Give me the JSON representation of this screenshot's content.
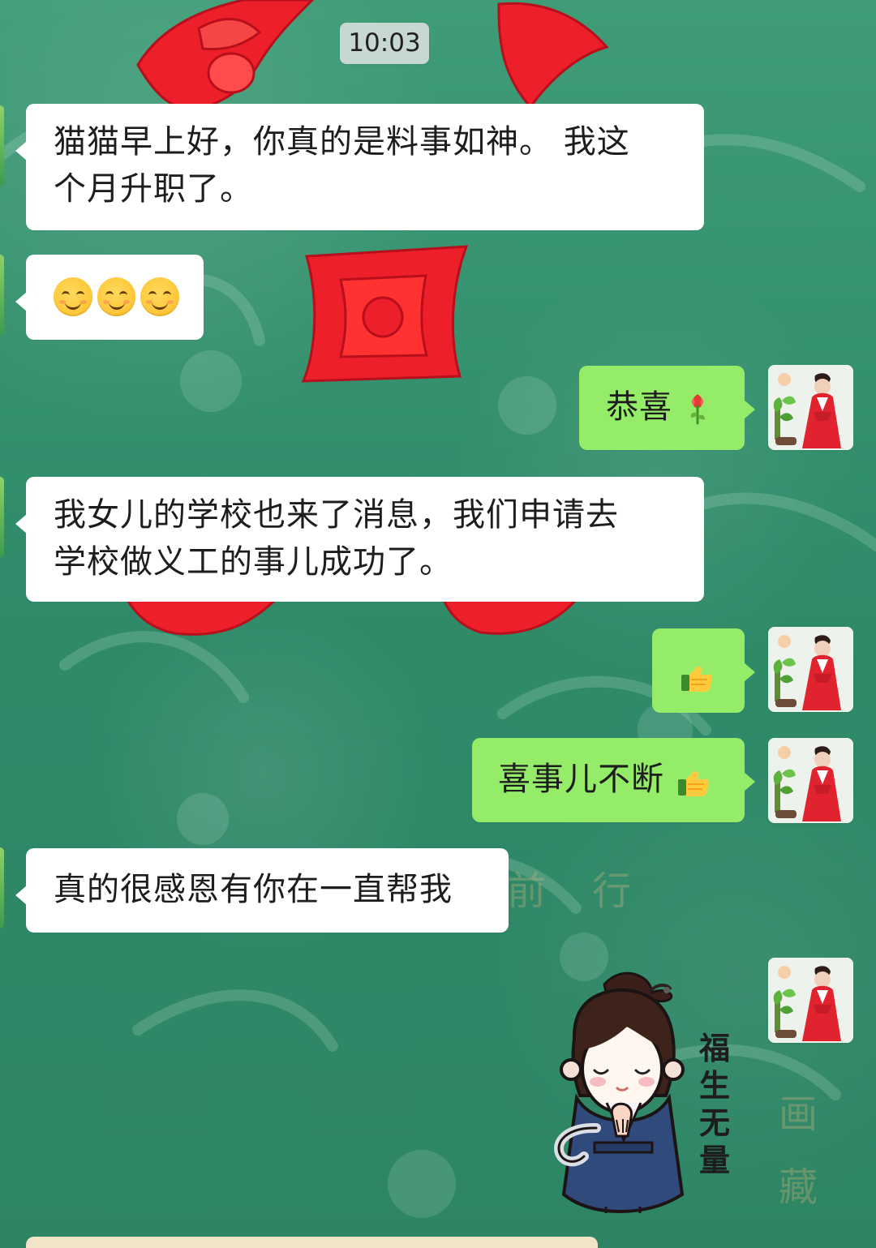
{
  "chat": {
    "timestamp": "10:03",
    "messages": [
      {
        "sender": "left",
        "text": "猫猫早上好，你真的是料事如神。 我这\n个月升职了。"
      },
      {
        "sender": "left",
        "emoji": [
          "smiling-face-icon",
          "smiling-face-icon",
          "smiling-face-icon"
        ]
      },
      {
        "sender": "right",
        "text": "恭喜",
        "trailing_icon": "tulip-icon"
      },
      {
        "sender": "left",
        "text": "我女儿的学校也来了消息，我们申请去\n学校做义工的事儿成功了。"
      },
      {
        "sender": "right",
        "icon": "thumbs-up-icon"
      },
      {
        "sender": "right",
        "text": "喜事儿不断",
        "trailing_icon": "thumbs-up-icon"
      },
      {
        "sender": "left",
        "text": "真的很感恩有你在一直帮我"
      },
      {
        "sender": "right",
        "sticker": {
          "caption": "福生无量",
          "icon": "praying-girl-sticker"
        }
      }
    ]
  },
  "colors": {
    "chat_background": "#2f8a68",
    "incoming_bubble": "#ffffff",
    "outgoing_bubble": "#95ec69"
  }
}
